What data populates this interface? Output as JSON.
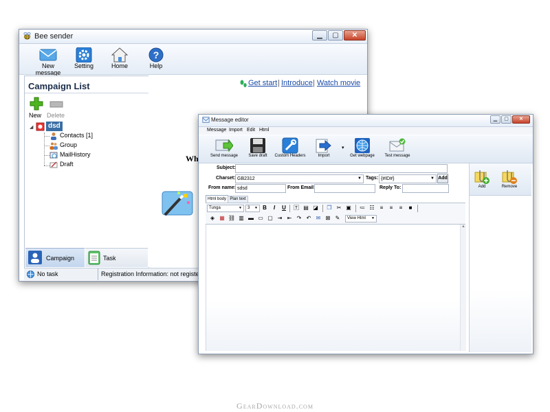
{
  "main_window": {
    "title": "Bee sender",
    "toolbar": [
      {
        "label": "New message",
        "icon": "envelope-icon"
      },
      {
        "label": "Setting",
        "icon": "gear-icon"
      },
      {
        "label": "Home",
        "icon": "home-icon"
      },
      {
        "label": "Help",
        "icon": "help-icon"
      }
    ],
    "campaign_list_title": "Campaign List",
    "new_label": "New",
    "delete_label": "Delete",
    "tree": {
      "root": "dsd",
      "children": [
        "Contacts [1]",
        "Group",
        "MailHistory",
        "Draft"
      ]
    },
    "links": {
      "get_start": "Get start",
      "introduce": "Introduce",
      "watch_movie": "Watch movie",
      "separator": "|"
    },
    "partial_text": "Wh",
    "tabs": {
      "campaign": "Campaign",
      "task": "Task"
    },
    "status": {
      "task": "No task",
      "registration": "Registration Information: not register"
    }
  },
  "editor_window": {
    "title": "Message editor",
    "menu": [
      "Message",
      "Import",
      "Edit",
      "Html"
    ],
    "toolbar": [
      {
        "label": "Send message",
        "icon": "send-arrow-icon"
      },
      {
        "label": "Save draft",
        "icon": "floppy-disk-icon"
      },
      {
        "label": "Custom Headers",
        "icon": "wrench-icon"
      },
      {
        "label": "Import",
        "icon": "import-arrow-icon"
      },
      {
        "label": "Get webpage",
        "icon": "globe-icon"
      },
      {
        "label": "Test message",
        "icon": "envelope-check-icon"
      }
    ],
    "fields": {
      "subject_label": "Subject:",
      "subject_value": "",
      "charset_label": "Charset:",
      "charset_value": "GB2312",
      "tags_label": "Tags:",
      "tags_value": "{#ID#}",
      "add_button": "Add",
      "from_name_label": "From name:",
      "from_name_value": "sdsd",
      "from_email_label": "From Email:",
      "from_email_value": "",
      "reply_to_label": "Reply To:",
      "reply_to_value": ""
    },
    "body_tabs": [
      "Html body",
      "Plan text"
    ],
    "font_name": "Tunga",
    "font_size": "3",
    "format_buttons": [
      "B",
      "I",
      "U"
    ],
    "view_mode": "View Html",
    "attach": {
      "add": "Add",
      "remove": "Remove"
    }
  },
  "watermark": "GearDownload.com"
}
